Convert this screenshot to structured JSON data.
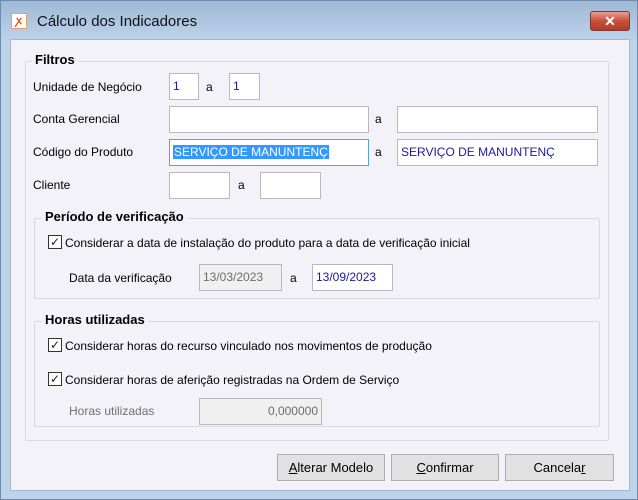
{
  "window": {
    "title": "Cálculo dos Indicadores",
    "icon": "app-logo-icon",
    "close_icon": "close-icon"
  },
  "filters": {
    "title": "Filtros",
    "sep": "a",
    "unidade": {
      "label": "Unidade de Negócio",
      "from": "1",
      "to": "1"
    },
    "conta": {
      "label": "Conta Gerencial",
      "from": "",
      "to": ""
    },
    "produto": {
      "label": "Código do Produto",
      "from": "SERVIÇO DE MANUNTENÇ",
      "to": "SERVIÇO DE MANUNTENÇ"
    },
    "cliente": {
      "label": "Cliente",
      "from": "",
      "to": ""
    }
  },
  "periodo": {
    "title": "Período de verificação",
    "checkbox_label": "Considerar a data de instalação do produto para a data de verificação inicial",
    "checked": true,
    "date_label": "Data da verificação",
    "date_from": "13/03/2023",
    "date_to": "13/09/2023"
  },
  "horas": {
    "title": "Horas utilizadas",
    "cb1_label": "Considerar horas do recurso vinculado nos movimentos de produção",
    "cb1_checked": true,
    "cb2_label": "Considerar horas de aferição registradas na Ordem de Serviço",
    "cb2_checked": true,
    "field_label": "Horas utilizadas",
    "field_value": "0,000000"
  },
  "buttons": {
    "alterar_u": "A",
    "alterar_rest": "lterar Modelo",
    "confirmar_u": "C",
    "confirmar_rest": "onfirmar",
    "cancelar_pre": "Cancela",
    "cancelar_u": "r"
  }
}
